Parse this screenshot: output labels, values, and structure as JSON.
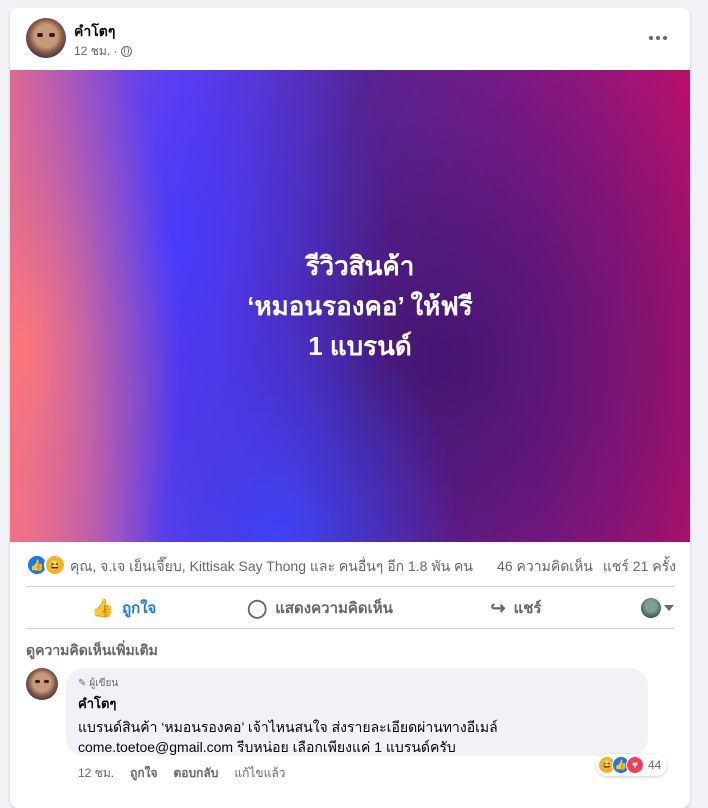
{
  "post": {
    "author": "คำโตๆ",
    "time": "12 ชม. ·",
    "banner_lines": [
      "รีวิวสินค้า",
      "‘หมอนรองคอ’ ให้ฟรี",
      "1 แบรนด์"
    ]
  },
  "stats": {
    "reactions_text": "คุณ, จ.เจ เย็นเจี๊ยบ, Kittisak Say Thong และ คนอื่นๆ อีก 1.8 พัน คน",
    "comments": "46 ความคิดเห็น",
    "shares": "แชร์ 21 ครั้ง"
  },
  "actions": {
    "like": "ถูกใจ",
    "comment": "แสดงความคิดเห็น",
    "share": "แชร์"
  },
  "more_comments": "ดูความคิดเห็นเพิ่มเติม",
  "comment": {
    "badge": "ผู้เขียน",
    "name": "คำโตๆ",
    "line1": "แบรนด์สินค้า ‘หมอนรองคอ’ เจ้าไหนสนใจ ส่งรายละเอียดผ่านทางอีเมล์",
    "line2": "come.toetoe@gmail.com รีบหน่อย เลือกเพียงแค่ 1 แบรนด์ครับ",
    "reaction_count": "44",
    "time": "12 ชม.",
    "like": "ถูกใจ",
    "reply": "ตอบกลับ",
    "edited": "แก้ไขแล้ว"
  },
  "colors": {
    "facebook_blue": "#1877f2",
    "muted_text": "#65676b"
  }
}
